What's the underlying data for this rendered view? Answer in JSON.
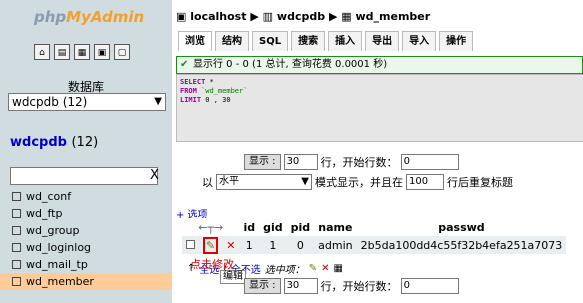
{
  "sidebar": {
    "logo_left": "php",
    "logo_right": "MyAdmin",
    "nav_icons": [
      "home-icon",
      "sql-icon",
      "docs-icon",
      "query-icon",
      "settings-icon"
    ],
    "db_label": "数据库",
    "db_selected": "wdcpdb (12)",
    "db_name": "wdcpdb",
    "db_count": "(12)",
    "filter_value": "",
    "filter_clear": "X",
    "tables": [
      "wd_conf",
      "wd_ftp",
      "wd_group",
      "wd_loginlog",
      "wd_mail_tp",
      "wd_member"
    ],
    "active_table": "wd_member"
  },
  "breadcrumb": {
    "server": "localhost",
    "db": "wdcpdb",
    "table": "wd_member",
    "sep": "▶"
  },
  "tabs": [
    "浏览",
    "结构",
    "SQL",
    "搜索",
    "插入",
    "导出",
    "导入",
    "操作"
  ],
  "notice": {
    "text": "显示行 0 - 0 (1 总计, 查询花费 0.0001 秒)"
  },
  "sql": {
    "line1_kw": "SELECT",
    "line1_rest": " *",
    "line2_kw": "FROM",
    "line2_rest": " `wd_member`",
    "line3_kw": "LIMIT",
    "line3_rest": " 0 , 30"
  },
  "nav_controls": {
    "show_button": "显示 :",
    "rows_value": "30",
    "rows_label": "行，开始行数：",
    "start_value": "0",
    "in_label": "以",
    "mode_value": "水平",
    "mode_label": "模式显示，并且在",
    "repeat_value": "100",
    "repeat_label": "行后重复标题"
  },
  "options_link": "+ 选项",
  "table": {
    "columns": [
      "id",
      "gid",
      "pid",
      "name",
      "passwd"
    ],
    "rows": [
      {
        "id": "1",
        "gid": "1",
        "pid": "0",
        "name": "admin",
        "passwd": "2b5da100dd4c55f32b4efa251a7073"
      }
    ]
  },
  "annotation_text": "点击修改",
  "tooltip_text": "编辑",
  "bulk": {
    "check_all": "全选",
    "sep": "/",
    "uncheck_all": "全不选",
    "with_selected": "选中项："
  }
}
